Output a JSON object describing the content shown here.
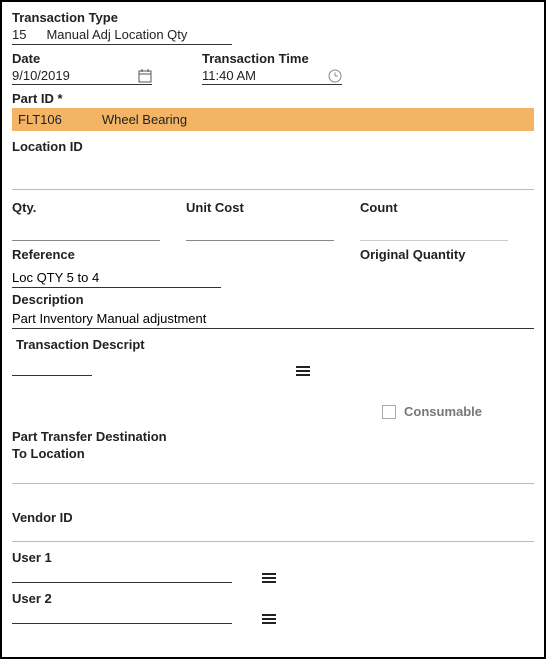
{
  "transactionType": {
    "label": "Transaction Type",
    "code": "15",
    "name": "Manual Adj Location Qty"
  },
  "date": {
    "label": "Date",
    "value": "9/10/2019"
  },
  "transactionTime": {
    "label": "Transaction Time",
    "value": "11:40 AM"
  },
  "partId": {
    "label": "Part ID *",
    "code": "FLT106",
    "name": "Wheel Bearing"
  },
  "locationId": {
    "label": "Location ID",
    "value": ""
  },
  "qty": {
    "label": "Qty.",
    "value": ""
  },
  "unitCost": {
    "label": "Unit Cost",
    "value": ""
  },
  "count": {
    "label": "Count",
    "value": ""
  },
  "reference": {
    "label": "Reference",
    "value": "Loc QTY 5 to 4"
  },
  "originalQuantity": {
    "label": "Original Quantity",
    "value": ""
  },
  "description": {
    "label": "Description",
    "value": "Part Inventory Manual adjustment"
  },
  "transactionDescript": {
    "label": "Transaction Descript",
    "value": ""
  },
  "consumable": {
    "label": "Consumable",
    "checked": false
  },
  "partTransferDest": {
    "label1": "Part Transfer Destination",
    "label2": "To Location",
    "value": ""
  },
  "vendorId": {
    "label": "Vendor ID",
    "value": ""
  },
  "user1": {
    "label": "User 1",
    "value": ""
  },
  "user2": {
    "label": "User 2",
    "value": ""
  }
}
